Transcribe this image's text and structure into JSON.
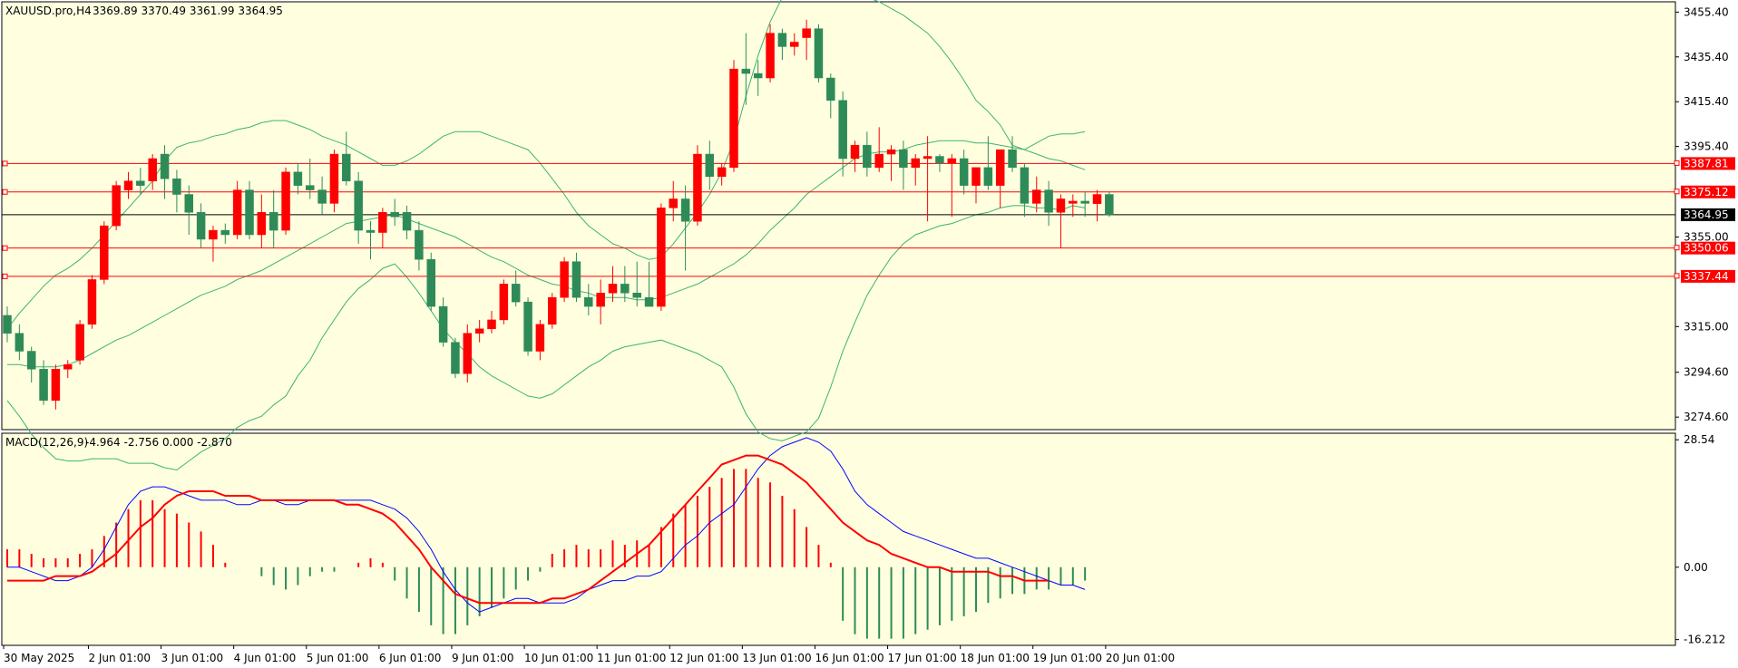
{
  "chart_data": [
    {
      "type": "candlestick",
      "title": "XAUUSD.pro,H4",
      "header_values": "3369.89 3370.49 3361.99 3364.95",
      "y_ticks": [
        "3455.40",
        "3435.40",
        "3415.40",
        "3395.40",
        "3355.00",
        "3315.00",
        "3294.60",
        "3274.60"
      ],
      "ylim": [
        3269,
        3460
      ],
      "x_ticks": [
        "30 May 2025",
        "2 Jun 01:00",
        "3 Jun 01:00",
        "4 Jun 01:00",
        "5 Jun 01:00",
        "6 Jun 01:00",
        "9 Jun 01:00",
        "10 Jun 01:00",
        "11 Jun 01:00",
        "12 Jun 01:00",
        "13 Jun 01:00",
        "16 Jun 01:00",
        "17 Jun 01:00",
        "18 Jun 01:00",
        "19 Jun 01:00",
        "20 Jun 01:00"
      ],
      "current_price": "3364.95",
      "horizontal_levels": [
        "3387.81",
        "3375.12",
        "3350.06",
        "3337.44"
      ],
      "candles": [
        [
          3320,
          3324,
          3308,
          3312
        ],
        [
          3312,
          3316,
          3300,
          3304
        ],
        [
          3304,
          3306,
          3290,
          3296
        ],
        [
          3296,
          3300,
          3280,
          3282
        ],
        [
          3282,
          3298,
          3278,
          3296
        ],
        [
          3296,
          3300,
          3292,
          3298
        ],
        [
          3300,
          3318,
          3298,
          3316
        ],
        [
          3316,
          3338,
          3314,
          3336
        ],
        [
          3336,
          3362,
          3334,
          3360
        ],
        [
          3360,
          3380,
          3358,
          3378
        ],
        [
          3376,
          3384,
          3372,
          3380
        ],
        [
          3380,
          3386,
          3374,
          3378
        ],
        [
          3380,
          3392,
          3376,
          3390
        ],
        [
          3392,
          3396,
          3372,
          3381
        ],
        [
          3381,
          3385,
          3366,
          3374
        ],
        [
          3374,
          3378,
          3356,
          3366
        ],
        [
          3366,
          3370,
          3350,
          3354
        ],
        [
          3354,
          3360,
          3344,
          3358
        ],
        [
          3358,
          3361,
          3352,
          3356
        ],
        [
          3356,
          3380,
          3354,
          3376
        ],
        [
          3376,
          3380,
          3354,
          3356
        ],
        [
          3356,
          3374,
          3350,
          3366
        ],
        [
          3366,
          3376,
          3350,
          3358
        ],
        [
          3358,
          3386,
          3356,
          3384
        ],
        [
          3384,
          3388,
          3374,
          3378
        ],
        [
          3378,
          3390,
          3372,
          3376
        ],
        [
          3376,
          3382,
          3365,
          3370
        ],
        [
          3370,
          3394,
          3366,
          3392
        ],
        [
          3392,
          3402,
          3378,
          3380
        ],
        [
          3380,
          3384,
          3352,
          3358
        ],
        [
          3358,
          3362,
          3345,
          3357
        ],
        [
          3357,
          3368,
          3350,
          3366
        ],
        [
          3366,
          3372,
          3360,
          3364
        ],
        [
          3366,
          3369,
          3354,
          3358
        ],
        [
          3358,
          3362,
          3340,
          3345
        ],
        [
          3345,
          3348,
          3322,
          3324
        ],
        [
          3324,
          3328,
          3306,
          3308
        ],
        [
          3308,
          3310,
          3292,
          3294
        ],
        [
          3294,
          3316,
          3290,
          3312
        ],
        [
          3312,
          3318,
          3308,
          3314
        ],
        [
          3314,
          3322,
          3312,
          3318
        ],
        [
          3318,
          3336,
          3316,
          3334
        ],
        [
          3334,
          3340,
          3324,
          3326
        ],
        [
          3326,
          3328,
          3302,
          3304
        ],
        [
          3304,
          3318,
          3300,
          3316
        ],
        [
          3316,
          3330,
          3314,
          3328
        ],
        [
          3328,
          3346,
          3326,
          3344
        ],
        [
          3344,
          3348,
          3326,
          3328
        ],
        [
          3328,
          3334,
          3320,
          3324
        ],
        [
          3324,
          3336,
          3316,
          3330
        ],
        [
          3330,
          3342,
          3326,
          3334
        ],
        [
          3334,
          3342,
          3326,
          3330
        ],
        [
          3330,
          3344,
          3324,
          3328
        ],
        [
          3328,
          3344,
          3324,
          3324
        ],
        [
          3324,
          3370,
          3322,
          3368
        ],
        [
          3368,
          3380,
          3362,
          3372
        ],
        [
          3372,
          3378,
          3340,
          3362
        ],
        [
          3362,
          3396,
          3360,
          3392
        ],
        [
          3392,
          3398,
          3376,
          3382
        ],
        [
          3382,
          3388,
          3378,
          3386
        ],
        [
          3386,
          3434,
          3384,
          3430
        ],
        [
          3430,
          3446,
          3414,
          3428
        ],
        [
          3428,
          3434,
          3418,
          3426
        ],
        [
          3426,
          3450,
          3424,
          3446
        ],
        [
          3446,
          3448,
          3434,
          3440
        ],
        [
          3440,
          3446,
          3436,
          3442
        ],
        [
          3444,
          3452,
          3434,
          3448
        ],
        [
          3448,
          3450,
          3424,
          3426
        ],
        [
          3426,
          3428,
          3408,
          3416
        ],
        [
          3416,
          3420,
          3382,
          3390
        ],
        [
          3390,
          3398,
          3384,
          3396
        ],
        [
          3396,
          3402,
          3382,
          3386
        ],
        [
          3386,
          3404,
          3384,
          3392
        ],
        [
          3392,
          3396,
          3380,
          3394
        ],
        [
          3394,
          3398,
          3376,
          3386
        ],
        [
          3386,
          3392,
          3378,
          3390
        ],
        [
          3390,
          3400,
          3362,
          3391
        ],
        [
          3391,
          3392,
          3384,
          3388
        ],
        [
          3388,
          3392,
          3364,
          3390
        ],
        [
          3390,
          3394,
          3374,
          3378
        ],
        [
          3378,
          3384,
          3370,
          3386
        ],
        [
          3386,
          3400,
          3376,
          3378
        ],
        [
          3378,
          3392,
          3368,
          3394
        ],
        [
          3394,
          3400,
          3384,
          3386
        ],
        [
          3386,
          3388,
          3364,
          3370
        ],
        [
          3370,
          3382,
          3366,
          3376
        ],
        [
          3376,
          3380,
          3360,
          3366
        ],
        [
          3366,
          3374,
          3350,
          3372
        ],
        [
          3370,
          3374,
          3364,
          3371
        ],
        [
          3371,
          3375,
          3364,
          3370
        ],
        [
          3369.89,
          3376,
          3361.99,
          3374
        ],
        [
          3374,
          3375,
          3364,
          3364.95
        ]
      ],
      "bollinger": {
        "upper": [
          3314,
          3321,
          3327,
          3333,
          3338,
          3341,
          3345,
          3350,
          3356,
          3362,
          3368,
          3374,
          3380,
          3389,
          3395,
          3397,
          3398,
          3400,
          3401,
          3403,
          3404,
          3406,
          3407,
          3407,
          3405,
          3403,
          3400,
          3398,
          3396,
          3393,
          3390,
          3387,
          3387,
          3389,
          3392,
          3396,
          3400,
          3402,
          3402,
          3402,
          3400,
          3398,
          3396,
          3394,
          3388,
          3381,
          3374,
          3366,
          3360,
          3356,
          3352,
          3350,
          3347,
          3345,
          3346,
          3352,
          3359,
          3366,
          3374,
          3384,
          3398,
          3418,
          3436,
          3451,
          3462,
          3470,
          3478,
          3482,
          3476,
          3468,
          3464,
          3462,
          3460,
          3457,
          3454,
          3450,
          3446,
          3440,
          3433,
          3425,
          3416,
          3411,
          3405,
          3396,
          3394,
          3397,
          3400,
          3401,
          3401,
          3402
        ],
        "middle": [
          3298,
          3298,
          3297,
          3297,
          3297,
          3298,
          3300,
          3303,
          3306,
          3309,
          3311,
          3314,
          3317,
          3320,
          3323,
          3326,
          3329,
          3331,
          3333,
          3336,
          3338,
          3340,
          3343,
          3346,
          3349,
          3352,
          3355,
          3358,
          3361,
          3362,
          3363,
          3364,
          3365,
          3363,
          3361,
          3359,
          3357,
          3355,
          3352,
          3349,
          3346,
          3344,
          3341,
          3338,
          3336,
          3334,
          3333,
          3331,
          3330,
          3328,
          3328,
          3328,
          3327,
          3327,
          3328,
          3330,
          3332,
          3334,
          3337,
          3340,
          3343,
          3347,
          3352,
          3358,
          3363,
          3368,
          3374,
          3378,
          3382,
          3386,
          3390,
          3392,
          3393,
          3393,
          3394,
          3396,
          3397,
          3398,
          3398,
          3398,
          3397,
          3397,
          3396,
          3395,
          3394,
          3392,
          3390,
          3389,
          3387,
          3385
        ],
        "lower": [
          3282,
          3275,
          3267,
          3261,
          3256,
          3255,
          3255,
          3256,
          3256,
          3256,
          3254,
          3254,
          3254,
          3252,
          3251,
          3255,
          3259,
          3262,
          3265,
          3270,
          3273,
          3275,
          3280,
          3284,
          3293,
          3300,
          3310,
          3318,
          3326,
          3332,
          3336,
          3341,
          3343,
          3337,
          3330,
          3322,
          3314,
          3308,
          3303,
          3297,
          3293,
          3290,
          3287,
          3284,
          3283,
          3285,
          3289,
          3293,
          3297,
          3300,
          3304,
          3306,
          3307,
          3308,
          3309,
          3307,
          3305,
          3303,
          3300,
          3297,
          3288,
          3276,
          3268,
          3265,
          3264,
          3266,
          3268,
          3274,
          3288,
          3304,
          3317,
          3329,
          3338,
          3346,
          3352,
          3356,
          3358,
          3360,
          3361,
          3363,
          3365,
          3366,
          3368,
          3369,
          3369,
          3368,
          3368,
          3367,
          3369,
          3368
        ]
      },
      "xlabel": "",
      "ylabel": ""
    },
    {
      "type": "macd",
      "title": "MACD(12,26,9)",
      "header_values": "-4.964 -2.756 0.000 -2.870",
      "y_ticks": [
        "28.54",
        "0.00",
        "-16.212"
      ],
      "ylim": [
        -17.5,
        30
      ],
      "histogram": [
        4,
        4,
        3,
        2,
        2,
        2,
        3,
        4,
        7,
        10,
        13,
        15,
        15,
        13,
        12,
        10,
        8,
        5,
        1,
        0,
        0,
        -2,
        -4,
        -5,
        -4,
        -2,
        -1,
        -1,
        0,
        1,
        2,
        1,
        -3,
        -7,
        -10,
        -13,
        -15,
        -15,
        -13,
        -11,
        -9,
        -7,
        -5,
        -3,
        -1,
        3,
        4,
        5,
        4,
        4,
        6,
        5,
        6,
        5,
        9,
        12,
        14,
        16,
        18,
        20,
        22,
        22,
        20,
        19,
        16,
        13,
        9,
        5,
        1,
        -12,
        -15,
        -16,
        -16,
        -16,
        -16,
        -15,
        -14,
        -13,
        -12,
        -11,
        -10,
        -8,
        -7,
        -6,
        -6,
        -5,
        -5,
        -4,
        -4,
        -3
      ],
      "macd_line": [
        0,
        0,
        -1,
        -2,
        -3,
        -3,
        -2,
        0,
        4,
        9,
        14,
        17,
        18,
        18,
        17,
        16,
        15,
        15,
        15,
        14,
        14,
        15,
        15,
        14,
        14,
        15,
        15,
        15,
        15,
        15,
        15,
        14,
        13,
        11,
        8,
        4,
        -1,
        -5,
        -8,
        -10,
        -9,
        -8,
        -7,
        -7,
        -8,
        -8,
        -8,
        -7,
        -5,
        -4,
        -3,
        -3,
        -2,
        -2,
        -1,
        2,
        5,
        7,
        10,
        12,
        14,
        18,
        22,
        25,
        27,
        28,
        29,
        28,
        26,
        22,
        17,
        14,
        12,
        10,
        8,
        7,
        6,
        5,
        4,
        3,
        2,
        2,
        1,
        0,
        -1,
        -2,
        -3,
        -4,
        -4,
        -5
      ],
      "signal_line": [
        -3,
        -3,
        -3,
        -3,
        -2,
        -2,
        -2,
        -1,
        1,
        3,
        6,
        9,
        11,
        14,
        16,
        17,
        17,
        17,
        16,
        16,
        16,
        15,
        15,
        15,
        15,
        15,
        15,
        15,
        14,
        14,
        13,
        12,
        10,
        7,
        4,
        0,
        -3,
        -6,
        -7,
        -8,
        -8,
        -8,
        -8,
        -8,
        -8,
        -7,
        -7,
        -6,
        -5,
        -3,
        -1,
        1,
        3,
        5,
        8,
        11,
        14,
        17,
        20,
        23,
        24,
        25,
        25,
        24,
        23,
        21,
        19,
        16,
        13,
        10,
        8,
        6,
        5,
        3,
        2,
        1,
        0,
        0,
        -1,
        -1,
        -1,
        -1,
        -2,
        -2,
        -3,
        -3,
        -3
      ]
    }
  ],
  "colors": {
    "background": "#ffffe0",
    "bull": "#ff0000",
    "bear": "#2e8b57",
    "band": "#3cb371",
    "level_line": "#ff0000",
    "current_line": "#000000",
    "macd_line": "#0000ff",
    "signal_line": "#ff0000"
  }
}
